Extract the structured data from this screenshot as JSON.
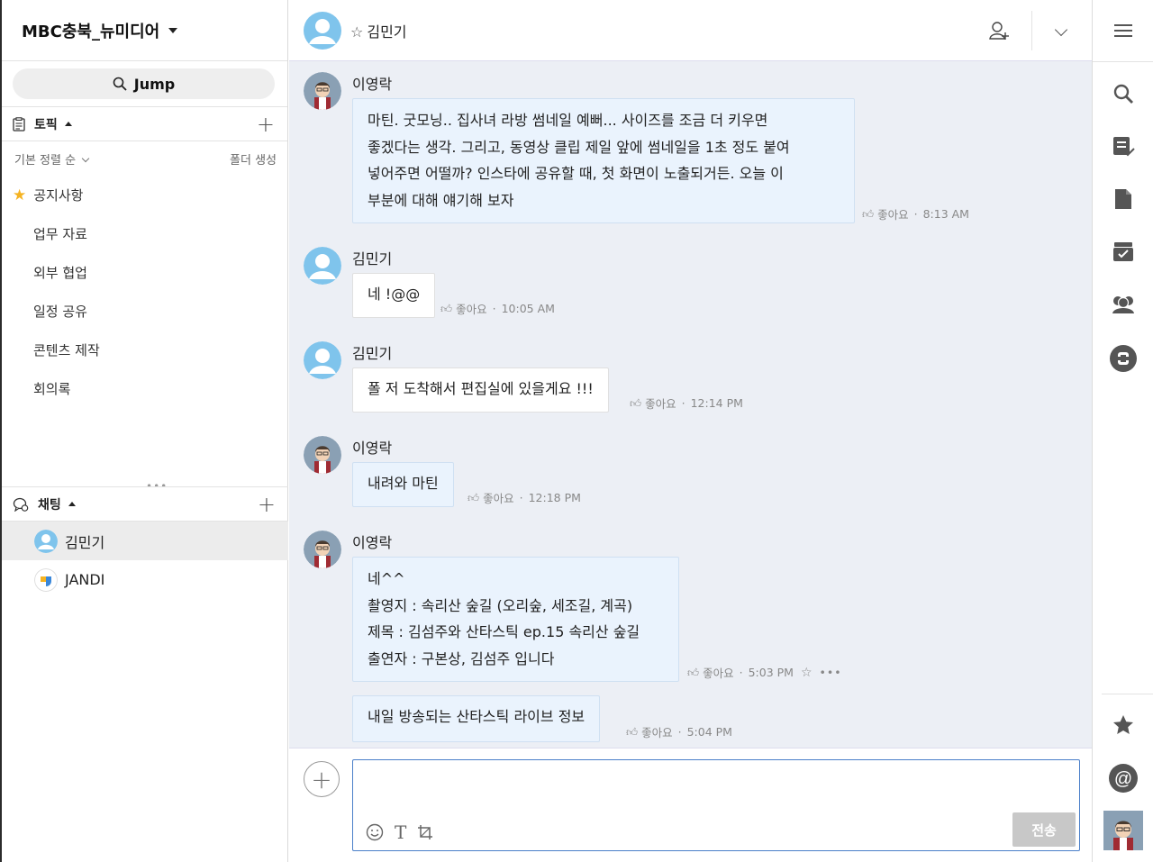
{
  "sidebar": {
    "team_name": "MBC충북_뉴미디어",
    "jump_label": "Jump",
    "topics_header": "토픽",
    "sort_label": "기본 정렬 순",
    "create_folder": "폴더 생성",
    "topics": [
      {
        "label": "공지사항",
        "favorite": true
      },
      {
        "label": "업무 자료"
      },
      {
        "label": "외부 협업"
      },
      {
        "label": "일정 공유"
      },
      {
        "label": "콘텐츠 제작"
      },
      {
        "label": "회의록"
      }
    ],
    "chat_header": "채팅",
    "chats": [
      {
        "label": "김민기",
        "active": true
      },
      {
        "label": "JANDI"
      }
    ]
  },
  "header": {
    "chat_title": "김민기"
  },
  "messages": [
    {
      "sender": "이영락",
      "avatar": "avatar-lee",
      "lines": [
        "마틴. 굿모닝.. 집사녀 라방 썸네일 예뻐... 사이즈를 조금 더 키우면",
        "좋겠다는 생각. 그리고, 동영상 클립 제일 앞에 썸네일을 1초 정도 붙여",
        "넣어주면 어떨까? 인스타에 공유할 때, 첫 화면이 노출되거든. 오늘 이",
        "부분에 대해 얘기해 보자"
      ],
      "like": "좋아요",
      "time": "8:13 AM"
    },
    {
      "sender": "김민기",
      "avatar": "avatar-kim",
      "lines": [
        "네 !@@"
      ],
      "like": "좋아요",
      "time": "10:05 AM"
    },
    {
      "sender": "김민기",
      "avatar": "avatar-kim",
      "lines": [
        "폴 저 도착해서 편집실에 있을게요 !!!"
      ],
      "like": "좋아요",
      "time": "12:14 PM"
    },
    {
      "sender": "이영락",
      "avatar": "avatar-lee",
      "lines": [
        "내려와 마틴"
      ],
      "like": "좋아요",
      "time": "12:18 PM"
    },
    {
      "sender": "이영락",
      "avatar": "avatar-lee",
      "lines": [
        "네^^",
        "촬영지 : 속리산 숲길 (오리숲, 세조길, 계곡)",
        "제목 : 김섬주와 산타스틱 ep.15 속리산 숲길",
        "출연자 : 구본상, 김섬주 입니다"
      ],
      "like": "좋아요",
      "time": "5:03 PM"
    },
    {
      "sender": "",
      "lines": [
        "내일 방송되는 산타스틱 라이브 정보"
      ],
      "like": "좋아요",
      "time": "5:04 PM"
    }
  ],
  "composer": {
    "send_label": "전송"
  },
  "colors": {
    "bubble_bg": "#eaf3fd",
    "bubble_border": "#cfe0f2",
    "chat_bg": "#eceff5",
    "send_disabled": "#c8c8c8",
    "input_border": "#4a7fc9",
    "favorite_star": "#f5b321"
  }
}
